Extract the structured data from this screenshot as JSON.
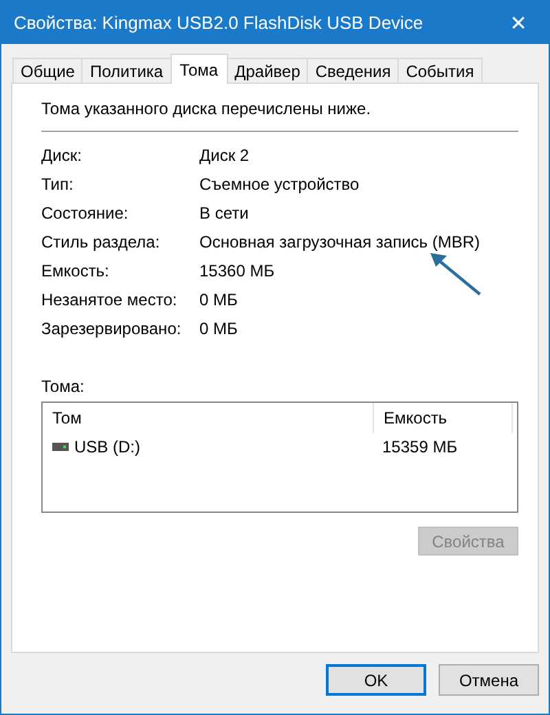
{
  "window": {
    "title": "Свойства: Kingmax USB2.0 FlashDisk USB Device",
    "close": "✕"
  },
  "tabs": [
    {
      "label": "Общие",
      "selected": false
    },
    {
      "label": "Политика",
      "selected": false
    },
    {
      "label": "Тома",
      "selected": true
    },
    {
      "label": "Драйвер",
      "selected": false
    },
    {
      "label": "Сведения",
      "selected": false
    },
    {
      "label": "События",
      "selected": false
    }
  ],
  "intro": "Тома указанного диска перечислены ниже.",
  "fields": [
    {
      "label": "Диск:",
      "value": "Диск 2"
    },
    {
      "label": "Тип:",
      "value": "Съемное устройство"
    },
    {
      "label": "Состояние:",
      "value": "В сети"
    },
    {
      "label": "Стиль раздела:",
      "value": "Основная загрузочная запись (MBR)"
    },
    {
      "label": "Емкость:",
      "value": "15360 МБ"
    },
    {
      "label": "Незанятое место:",
      "value": "0 МБ"
    },
    {
      "label": "Зарезервировано:",
      "value": "0 МБ"
    }
  ],
  "volumes": {
    "label": "Тома:",
    "columns": [
      "Том",
      "Емкость"
    ],
    "rows": [
      {
        "name": "USB (D:)",
        "capacity": "15359 МБ"
      }
    ],
    "button": {
      "label": "Свойства",
      "disabled": true
    }
  },
  "buttons": [
    {
      "label": "OK",
      "default": true
    },
    {
      "label": "Отмена",
      "default": false
    }
  ]
}
